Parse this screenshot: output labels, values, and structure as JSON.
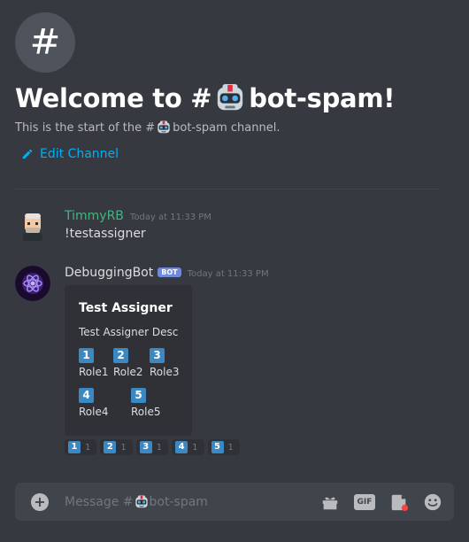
{
  "channel": {
    "welcome_prefix": "Welcome to #",
    "welcome_suffix": "bot-spam!",
    "intro_prefix": "This is the start of the #",
    "intro_suffix": "bot-spam channel.",
    "edit_label": "Edit Channel"
  },
  "messages": [
    {
      "username": "TimmyRB",
      "username_color": "#43b581",
      "timestamp": "Today at 11:33 PM",
      "text": "!testassigner"
    },
    {
      "username": "DebuggingBot",
      "username_color": "#dcddde",
      "bot_tag": "BOT",
      "timestamp": "Today at 11:33 PM",
      "embed": {
        "title": "Test Assigner",
        "description": "Test Assigner Desc",
        "roles": [
          {
            "num": "1",
            "label": "Role1"
          },
          {
            "num": "2",
            "label": "Role2"
          },
          {
            "num": "3",
            "label": "Role3"
          },
          {
            "num": "4",
            "label": "Role4"
          },
          {
            "num": "5",
            "label": "Role5"
          }
        ]
      },
      "reactions": [
        {
          "emoji": "1",
          "count": "1"
        },
        {
          "emoji": "2",
          "count": "1"
        },
        {
          "emoji": "3",
          "count": "1"
        },
        {
          "emoji": "4",
          "count": "1"
        },
        {
          "emoji": "5",
          "count": "1"
        }
      ]
    }
  ],
  "composer": {
    "placeholder_prefix": "Message #",
    "placeholder_suffix": "bot-spam",
    "icons": [
      "gift-icon",
      "gif-icon",
      "sticker-icon",
      "emoji-icon"
    ],
    "gif_label": "GIF"
  },
  "colors": {
    "background": "#36393f",
    "link": "#00b0f4",
    "number_box": "#3b88c3",
    "bot_tag": "#7289da"
  }
}
